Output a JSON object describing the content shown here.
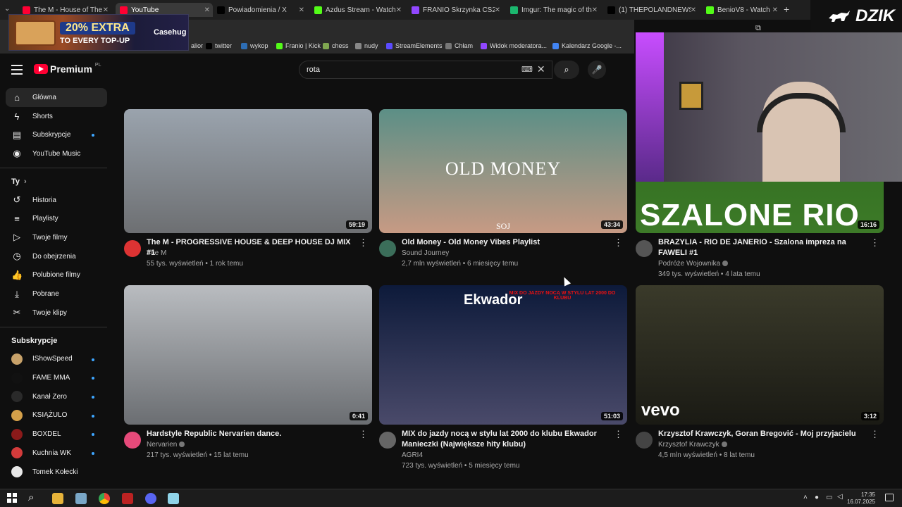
{
  "tabs": [
    {
      "label": "The M - House of The M",
      "color": "#ff0033",
      "active": false
    },
    {
      "label": "YouTube",
      "color": "#ff0033",
      "active": true
    },
    {
      "label": "Powiadomienia / X",
      "color": "#000000",
      "active": false
    },
    {
      "label": "Azdus Stream - Watch Li",
      "color": "#53fc18",
      "active": false
    },
    {
      "label": "FRANIO Skrzynka CS2 (C",
      "color": "#9147ff",
      "active": false
    },
    {
      "label": "Imgur: The magic of the I",
      "color": "#1bb76e",
      "active": false
    },
    {
      "label": "(1) THEPOLANDNEWS",
      "color": "#000000",
      "active": false
    },
    {
      "label": "BenioV8 - Watch clips on",
      "color": "#53fc18",
      "active": false
    }
  ],
  "bookmarks": [
    {
      "label": "alior",
      "color": "#c0392b"
    },
    {
      "label": "twitter",
      "color": "#000000"
    },
    {
      "label": "wykop",
      "color": "#2d6db4"
    },
    {
      "label": "Franio | Kick",
      "color": "#53fc18"
    },
    {
      "label": "chess",
      "color": "#7fa650"
    },
    {
      "label": "nudy",
      "color": "#888888"
    },
    {
      "label": "StreamElements",
      "color": "#5b4bff"
    },
    {
      "label": "Chłam",
      "color": "#777777"
    },
    {
      "label": "Widok moderatora...",
      "color": "#9147ff"
    },
    {
      "label": "Kalendarz Google -...",
      "color": "#4285f4"
    }
  ],
  "promo": {
    "headline": "20% EXTRA",
    "subline": "TO EVERY TOP-UP",
    "brand": "Casehug"
  },
  "overlay_brand": "DZIK",
  "youtube": {
    "logo_text": "Premium",
    "logo_region": "PL",
    "search_value": "rota"
  },
  "sidebar": {
    "main": [
      {
        "label": "Główna",
        "icon": "home-icon",
        "glyph": "⌂",
        "active": true
      },
      {
        "label": "Shorts",
        "icon": "shorts-icon",
        "glyph": "ϟ"
      },
      {
        "label": "Subskrypcje",
        "icon": "subscriptions-icon",
        "glyph": "▤",
        "dot": true
      },
      {
        "label": "YouTube Music",
        "icon": "music-icon",
        "glyph": "◉"
      }
    ],
    "you_header": "Ty",
    "you": [
      {
        "label": "Historia",
        "icon": "history-icon",
        "glyph": "↺"
      },
      {
        "label": "Playlisty",
        "icon": "playlists-icon",
        "glyph": "≡"
      },
      {
        "label": "Twoje filmy",
        "icon": "your-videos-icon",
        "glyph": "▷"
      },
      {
        "label": "Do obejrzenia",
        "icon": "watch-later-icon",
        "glyph": "◷"
      },
      {
        "label": "Polubione filmy",
        "icon": "liked-icon",
        "glyph": "👍"
      },
      {
        "label": "Pobrane",
        "icon": "downloads-icon",
        "glyph": "⤓"
      },
      {
        "label": "Twoje klipy",
        "icon": "clips-icon",
        "glyph": "✂"
      }
    ],
    "subs_header": "Subskrypcje",
    "subs": [
      {
        "label": "IShowSpeed",
        "color": "#c8a26a"
      },
      {
        "label": "FAME MMA",
        "color": "#111111"
      },
      {
        "label": "Kanał Zero",
        "color": "#2a2a2a"
      },
      {
        "label": "KSIĄŻULO",
        "color": "#d4a04a"
      },
      {
        "label": "BOXDEL",
        "color": "#8b1a1a"
      },
      {
        "label": "Kuchnia WK",
        "color": "#d33b3b"
      },
      {
        "label": "Tomek Kołecki",
        "color": "#e8e8e8"
      }
    ]
  },
  "videos": [
    {
      "title": "The M - PROGRESSIVE HOUSE & DEEP HOUSE DJ MIX #1",
      "channel": "The M",
      "verified": false,
      "views": "55 tys. wyświetleń",
      "age": "1 rok temu",
      "duration": "59:19",
      "thumb_top": "#9aa3ad",
      "thumb_bottom": "#6d6f72",
      "avatar": "#d33"
    },
    {
      "title": "Old Money - Old Money Vibes Playlist",
      "channel": "Sound Journey",
      "verified": false,
      "views": "2,7 mln wyświetleń",
      "age": "6 miesięcy temu",
      "duration": "43:34",
      "thumb_top": "#5c8f86",
      "thumb_bottom": "#c79a84",
      "avatar": "#3b6e5a",
      "thumb_text": "OLD MONEY",
      "thumb_mark": "SOJ"
    },
    {
      "title": "BRAZYLIA - RIO DE JANERIO - Szalona impreza na FAWELI #1",
      "channel": "Podróże Wojownika",
      "verified": true,
      "views": "349 tys. wyświetleń",
      "age": "4 lata temu",
      "duration": "16:16",
      "thumb_top": "#2d6a1e",
      "thumb_bottom": "#3d7a28",
      "avatar": "#555",
      "thumb_text": "SZALONE RIO"
    },
    {
      "title": "Hardstyle Republic Nervarien dance.",
      "channel": "Nervarien",
      "verified": true,
      "views": "217 tys. wyświetleń",
      "age": "15 lat temu",
      "duration": "0:41",
      "thumb_top": "#b9bcc0",
      "thumb_bottom": "#6b6e72",
      "avatar": "#e64a7a"
    },
    {
      "title": "MIX do jazdy nocą w stylu lat 2000 do klubu Ekwador Manieczki (Największe hity klubu)",
      "channel": "AGRI4",
      "verified": false,
      "views": "723 tys. wyświetleń",
      "age": "5 miesięcy temu",
      "duration": "51:03",
      "thumb_top": "#0d1a3a",
      "thumb_bottom": "#4a4a6a",
      "avatar": "#666",
      "thumb_text": "Ekwador",
      "thumb_mark": "MIX DO JAZDY NOCĄ W STYLU LAT 2000 DO KLUBU"
    },
    {
      "title": "Krzysztof Krawczyk, Goran Bregović - Moj przyjacielu",
      "channel": "Krzysztof Krawczyk",
      "verified": true,
      "views": "4,5 mln wyświetleń",
      "age": "8 lat temu",
      "duration": "3:12",
      "thumb_top": "#3a3a2a",
      "thumb_bottom": "#1a1a14",
      "avatar": "#444",
      "thumb_text": "vevo"
    }
  ],
  "clock": {
    "time": "17:35",
    "date": "16.07.2025"
  }
}
